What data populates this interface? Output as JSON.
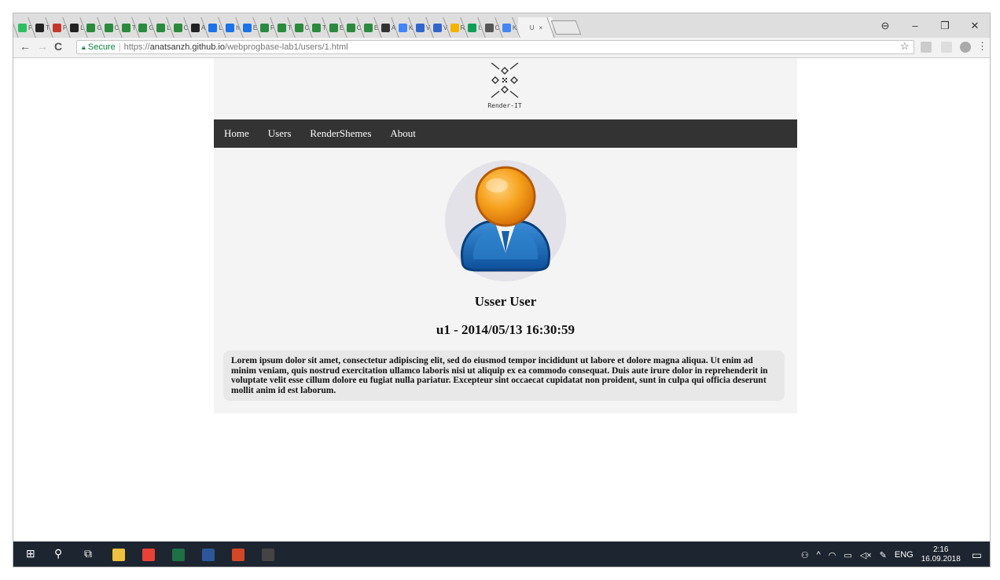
{
  "browser": {
    "tabs": [
      {
        "icon": "evernote-icon",
        "letter": "F",
        "color": "#2dbe60"
      },
      {
        "icon": "medium-icon",
        "letter": "T",
        "color": "#222222"
      },
      {
        "icon": "profile-icon",
        "letter": "P",
        "color": "#c0392b"
      },
      {
        "icon": "github-icon",
        "letter": "L",
        "color": "#222222"
      },
      {
        "icon": "code-icon",
        "letter": "G",
        "color": "#2b8a3e"
      },
      {
        "icon": "code-icon",
        "letter": "C",
        "color": "#2b8a3e"
      },
      {
        "icon": "code-icon",
        "letter": "T",
        "color": "#2b8a3e"
      },
      {
        "icon": "code-icon",
        "letter": "G",
        "color": "#2b8a3e"
      },
      {
        "icon": "code-icon",
        "letter": "L",
        "color": "#2b8a3e"
      },
      {
        "icon": "code-icon",
        "letter": "C",
        "color": "#2b8a3e"
      },
      {
        "icon": "github-icon",
        "letter": "A",
        "color": "#222222"
      },
      {
        "icon": "slides-icon",
        "letter": "L",
        "color": "#1a73e8"
      },
      {
        "icon": "slides-icon",
        "letter": "h",
        "color": "#1a73e8"
      },
      {
        "icon": "slides-icon",
        "letter": "E",
        "color": "#1a73e8"
      },
      {
        "icon": "code-icon",
        "letter": "F",
        "color": "#2b8a3e"
      },
      {
        "icon": "code-icon",
        "letter": "T",
        "color": "#2b8a3e"
      },
      {
        "icon": "code-icon",
        "letter": "C",
        "color": "#2b8a3e"
      },
      {
        "icon": "code-icon",
        "letter": "T",
        "color": "#2b8a3e"
      },
      {
        "icon": "code-icon",
        "letter": "E",
        "color": "#2b8a3e"
      },
      {
        "icon": "code-icon",
        "letter": "C",
        "color": "#2b8a3e"
      },
      {
        "icon": "code-icon",
        "letter": "E",
        "color": "#2b8a3e"
      },
      {
        "icon": "sitemap-icon",
        "letter": "A",
        "color": "#333333"
      },
      {
        "icon": "docs-icon",
        "letter": "K",
        "color": "#4285f4"
      },
      {
        "icon": "wikipedia-icon",
        "letter": "V",
        "color": "#3366cc"
      },
      {
        "icon": "wikipedia-icon",
        "letter": "V",
        "color": "#3366cc"
      },
      {
        "icon": "drive-icon",
        "letter": "R",
        "color": "#f4b400"
      },
      {
        "icon": "drive-icon",
        "letter": "I:",
        "color": "#0f9d58"
      },
      {
        "icon": "pb-icon",
        "letter": "C",
        "color": "#555555"
      },
      {
        "icon": "docs-icon",
        "letter": "K",
        "color": "#4285f4"
      }
    ],
    "active_tab": {
      "letter": "U",
      "close": "×"
    },
    "window_controls": {
      "profile": "⊖",
      "minimize": "–",
      "restore": "❐",
      "close": "✕"
    },
    "nav": {
      "back": "←",
      "forward": "→",
      "reload": "C"
    },
    "address": {
      "secure_label": "Secure",
      "scheme": "https://",
      "host": "anatsanzh.github.io",
      "path": "/webprogbase-lab1/users/1.html"
    },
    "star": "☆",
    "menu": "⋮"
  },
  "site": {
    "logo_text": "Render-IT",
    "nav": [
      "Home",
      "Users",
      "RenderShemes",
      "About"
    ],
    "user": {
      "name": "Usser User",
      "meta": "u1 - 2014/05/13 16:30:59",
      "bio": "Lorem ipsum dolor sit amet, consectetur adipiscing elit, sed do eiusmod tempor incididunt ut labore et dolore magna aliqua. Ut enim ad minim veniam, quis nostrud exercitation ullamco laboris nisi ut aliquip ex ea commodo consequat. Duis aute irure dolor in reprehenderit in voluptate velit esse cillum dolore eu fugiat nulla pariatur. Excepteur sint occaecat cupidatat non proident, sunt in culpa qui officia deserunt mollit anim id est laborum."
    }
  },
  "taskbar": {
    "apps": [
      {
        "name": "explorer-icon",
        "color": "#f0c040"
      },
      {
        "name": "chrome-icon",
        "color": "#e94235"
      },
      {
        "name": "excel-icon",
        "color": "#1e7145"
      },
      {
        "name": "word-icon",
        "color": "#2b579a"
      },
      {
        "name": "powerpoint-icon",
        "color": "#d24726"
      },
      {
        "name": "terminal-icon",
        "color": "#444444"
      }
    ],
    "lang": "ENG",
    "time": "2:16",
    "date": "16.09.2018"
  }
}
